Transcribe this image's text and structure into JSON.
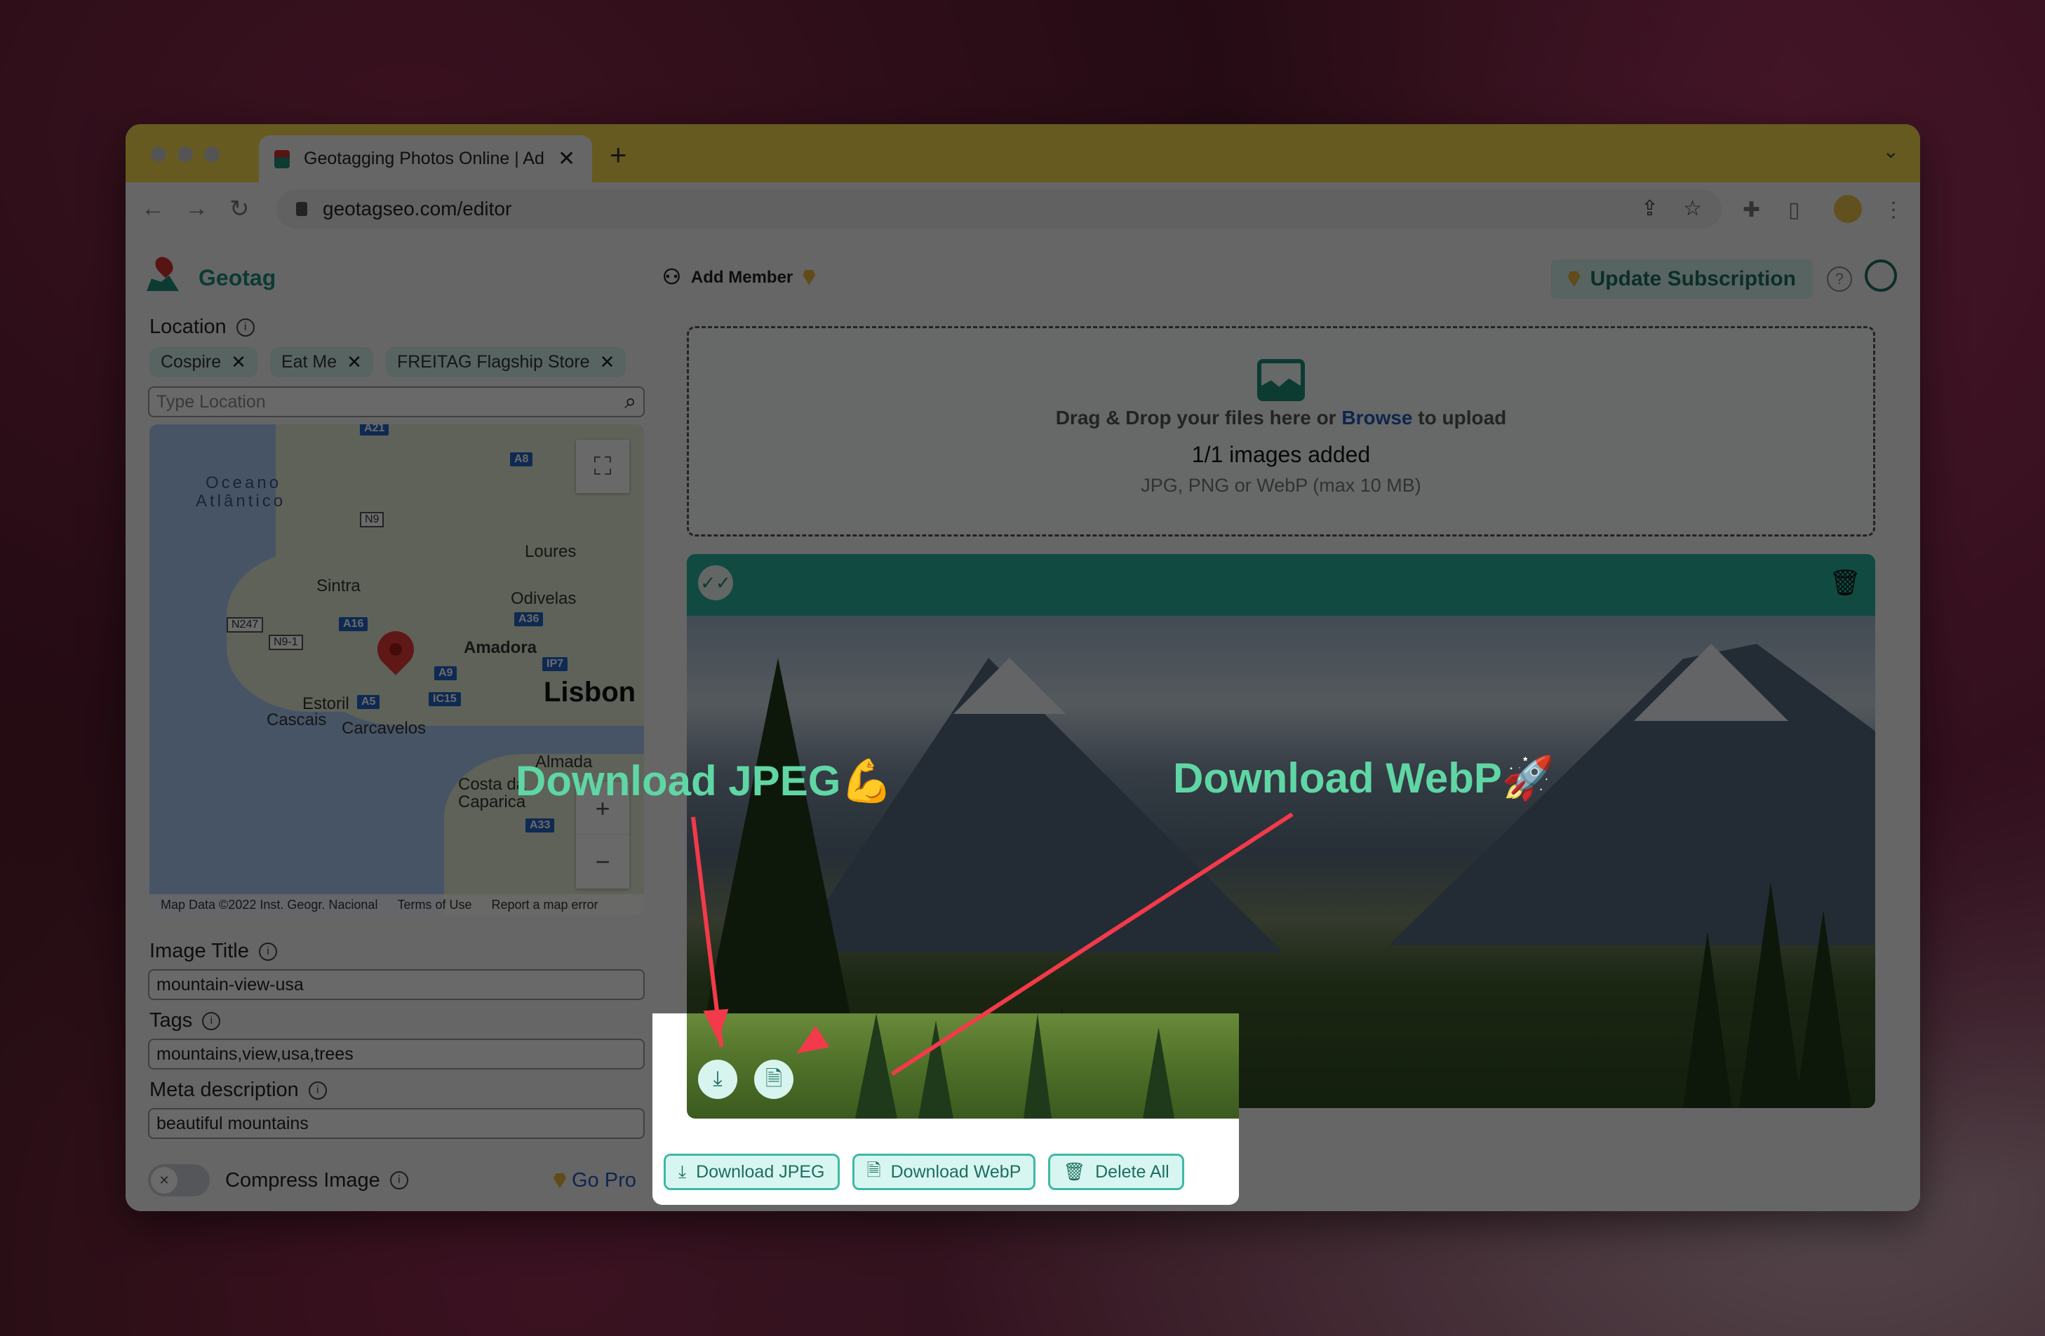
{
  "browser": {
    "tab_title": "Geotagging Photos Online | Ad",
    "new_tab": "+",
    "url": "geotagseo.com/editor",
    "icons": [
      "back-icon",
      "forward-icon",
      "reload-icon",
      "lock-icon",
      "share-icon",
      "star-icon",
      "extensions-icon",
      "side-panel-icon",
      "profile-avatar",
      "more-menu-icon"
    ]
  },
  "app": {
    "logo_text": "Geotag",
    "add_member": "Add Member",
    "update_subscription": "Update Subscription"
  },
  "sidebar": {
    "location_label": "Location",
    "location_chips": [
      {
        "label": "Cospire"
      },
      {
        "label": "Eat Me"
      },
      {
        "label": "FREITAG Flagship Store"
      }
    ],
    "location_placeholder": "Type Location",
    "map": {
      "labels": {
        "ocean": "Oceano",
        "ocean2": "Atlântico",
        "loures": "Loures",
        "sintra": "Sintra",
        "odivelas": "Odivelas",
        "amadora": "Amadora",
        "lisbon": "Lisbon",
        "estoril": "Estoril",
        "cascais": "Cascais",
        "carcavelos": "Carcavelos",
        "almada": "Almada",
        "costa": "Costa da",
        "caparica": "Caparica"
      },
      "roads": {
        "a21": "A21",
        "a8": "A8",
        "n9": "N9",
        "n247": "N247",
        "n91": "N9-1",
        "a16": "A16",
        "a36": "A36",
        "ip7": "IP7",
        "a9": "A9",
        "a5": "A5",
        "ic15": "IC15",
        "a33": "A33"
      },
      "footer": {
        "data": "Map Data ©2022 Inst. Geogr. Nacional",
        "terms": "Terms of Use",
        "report": "Report a map error"
      }
    },
    "image_title_label": "Image Title",
    "image_title_value": "mountain-view-usa",
    "tags_label": "Tags",
    "tags_value": "mountains,view,usa,trees",
    "meta_label": "Meta description",
    "meta_value": "beautiful mountains",
    "compress_label": "Compress Image",
    "compress_on": false,
    "go_pro": "Go Pro"
  },
  "upload": {
    "drag_text": "Drag & Drop your files here or",
    "browse": "Browse",
    "to_upload": "to upload",
    "count": "1/1 images added",
    "formats": "JPG, PNG or WebP (max 10 MB)"
  },
  "actions": {
    "download_jpeg": "Download JPEG",
    "download_webp": "Download WebP",
    "delete_all": "Delete All"
  },
  "annotations": {
    "jpeg": "Download JPEG💪",
    "webp": "Download WebP🚀"
  },
  "colors": {
    "accent": "#1e8c78",
    "tabbar": "#f2d64f",
    "annotation_text": "#5fd6a4",
    "arrow": "#f23a4a",
    "browse_link": "#2459b8"
  }
}
